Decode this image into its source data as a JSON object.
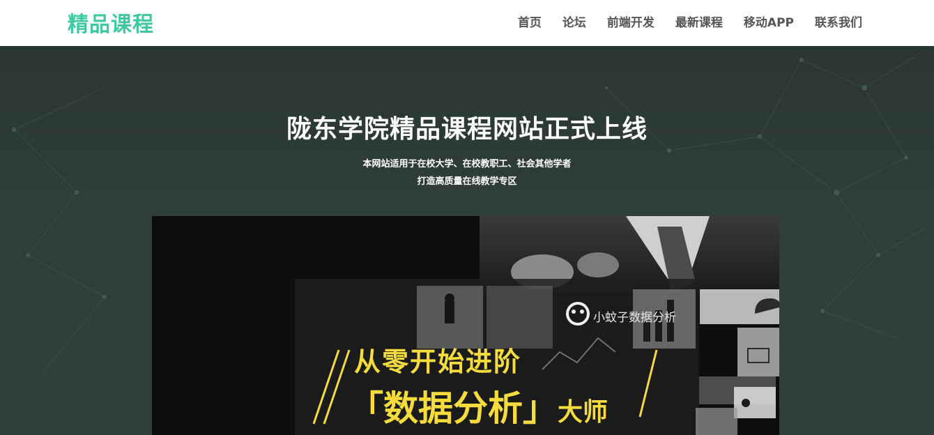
{
  "header": {
    "logo": "精品课程",
    "nav": [
      "首页",
      "论坛",
      "前端开发",
      "最新课程",
      "移动APP",
      "联系我们"
    ]
  },
  "hero": {
    "title": "陇东学院精品课程网站正式上线",
    "subtitle_line1": "本网站适用于在校大学、在校教职工、社会其他学者",
    "subtitle_line2": "打造高质量在线教学专区"
  },
  "banner": {
    "brand": "小蚊子数据分析",
    "line1": "从零开始进阶",
    "line2_main": "「数据分析」",
    "line2_suffix": "大师"
  },
  "colors": {
    "logo": "#3ec9a0",
    "nav_text": "#555555",
    "hero_bg": "#2f3e3a",
    "banner_text": "#f4dc3c"
  }
}
